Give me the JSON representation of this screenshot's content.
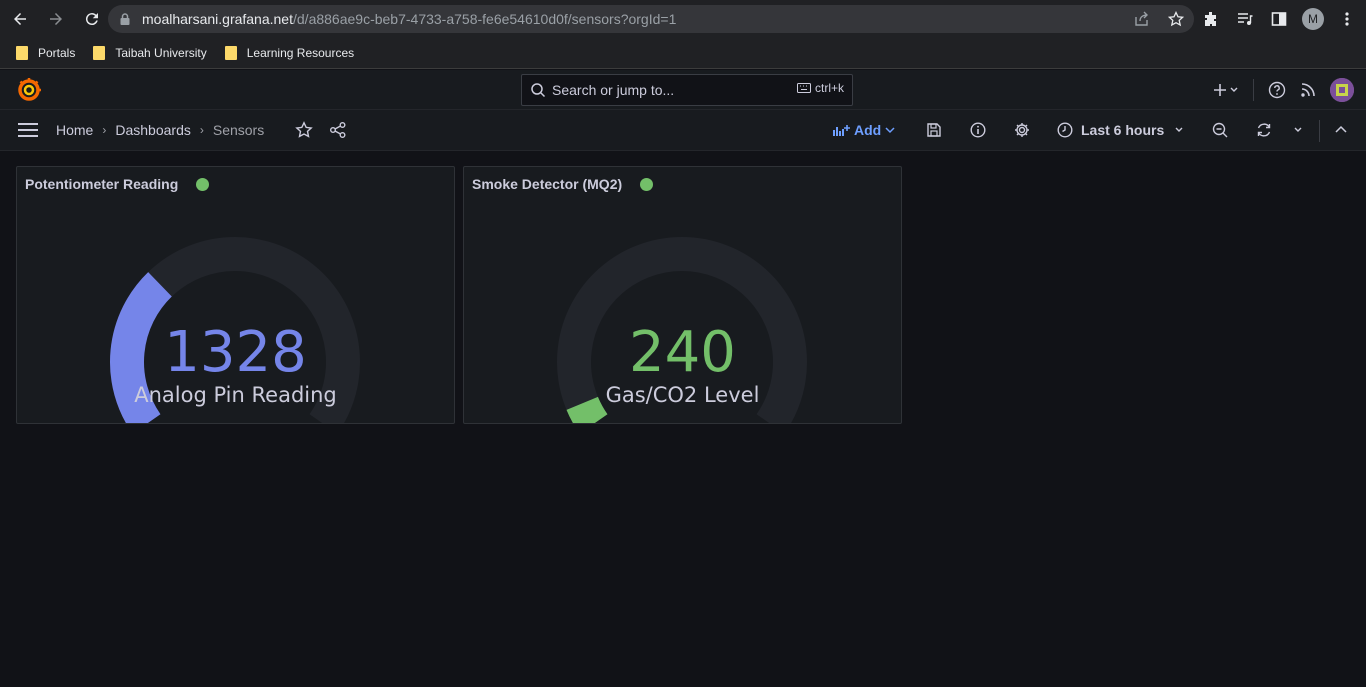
{
  "browser": {
    "url_host": "moalharsani.grafana.net",
    "url_path": "/d/a886ae9c-beb7-4733-a758-fe6e54610d0f/sensors?orgId=1",
    "profile_initial": "M",
    "bookmarks": [
      "Portals",
      "Taibah University",
      "Learning Resources"
    ]
  },
  "grafana": {
    "search_placeholder": "Search or jump to...",
    "search_shortcut": "ctrl+k",
    "breadcrumbs": [
      "Home",
      "Dashboards",
      "Sensors"
    ],
    "add_label": "Add",
    "time_range": "Last 6 hours"
  },
  "panels": [
    {
      "title": "Potentiometer Reading",
      "value": "1328",
      "unit_label": "Analog Pin Reading",
      "color": "#7585e9",
      "fill_fraction": 0.324
    },
    {
      "title": "Smoke Detector (MQ2)",
      "value": "240",
      "unit_label": "Gas/CO2 Level",
      "color": "#73bf69",
      "fill_fraction": 0.05
    }
  ],
  "colors": {
    "background": "#111217",
    "panel": "#181b1f",
    "gauge_track": "#22252b",
    "status_ok": "#73bf69",
    "accent": "#6e9fff"
  }
}
